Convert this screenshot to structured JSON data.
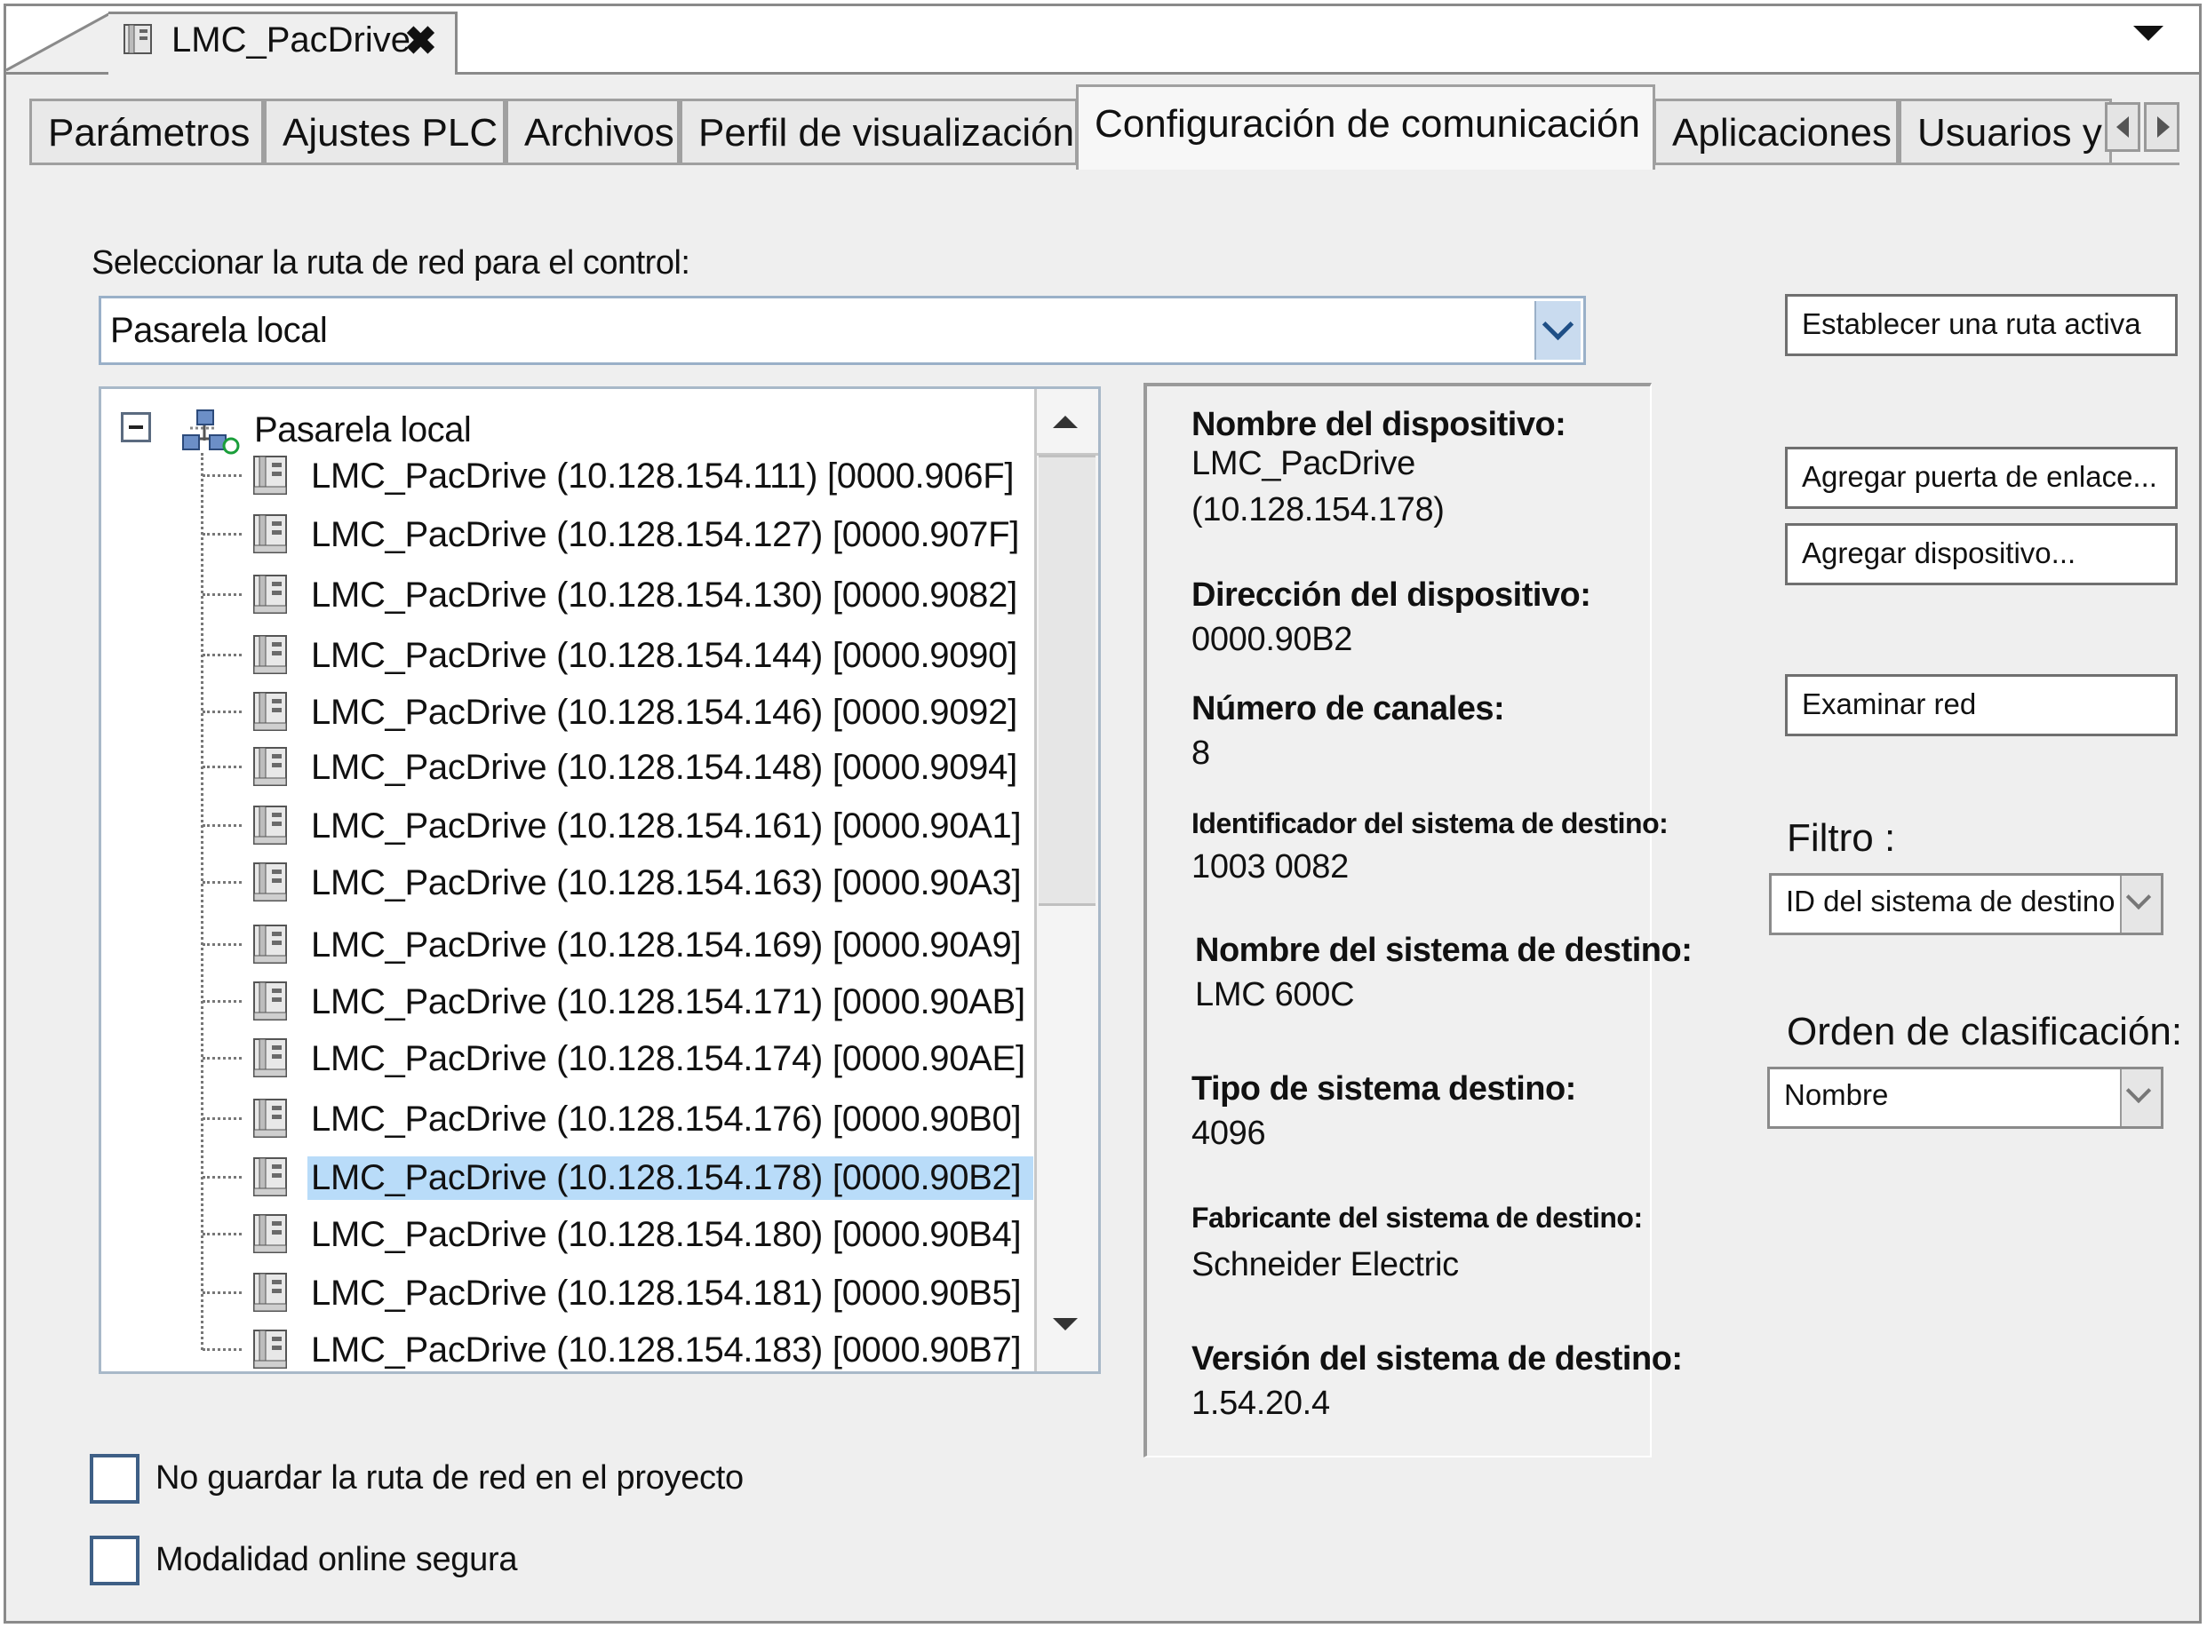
{
  "document_tab": {
    "title": "LMC_PacDrive",
    "close_glyph": "✖"
  },
  "tabs": [
    {
      "label": "Parámetros",
      "active": false
    },
    {
      "label": "Ajustes PLC",
      "active": false
    },
    {
      "label": "Archivos",
      "active": false
    },
    {
      "label": "Perfil de visualización",
      "active": false
    },
    {
      "label": "Configuración de comunicación",
      "active": true
    },
    {
      "label": "Aplicaciones",
      "active": false
    },
    {
      "label": "Usuarios y grupos",
      "active": false
    }
  ],
  "route": {
    "label": "Seleccionar la ruta de red para el control:",
    "value": "Pasarela local"
  },
  "tree": {
    "root": "Pasarela local",
    "nodes": [
      "LMC_PacDrive (10.128.154.111) [0000.906F]",
      "LMC_PacDrive (10.128.154.127) [0000.907F]",
      "LMC_PacDrive (10.128.154.130) [0000.9082]",
      "LMC_PacDrive (10.128.154.144) [0000.9090]",
      "LMC_PacDrive (10.128.154.146) [0000.9092]",
      "LMC_PacDrive (10.128.154.148) [0000.9094]",
      "LMC_PacDrive (10.128.154.161) [0000.90A1]",
      "LMC_PacDrive (10.128.154.163) [0000.90A3]",
      "LMC_PacDrive (10.128.154.169) [0000.90A9]",
      "LMC_PacDrive (10.128.154.171) [0000.90AB]",
      "LMC_PacDrive (10.128.154.174) [0000.90AE]",
      "LMC_PacDrive (10.128.154.176) [0000.90B0]",
      "LMC_PacDrive (10.128.154.178) [0000.90B2]",
      "LMC_PacDrive (10.128.154.180) [0000.90B4]",
      "LMC_PacDrive (10.128.154.181) [0000.90B5]",
      "LMC_PacDrive (10.128.154.183) [0000.90B7]"
    ],
    "selected_index": 12
  },
  "device_info": {
    "name_label": "Nombre del dispositivo:",
    "name_value_1": "LMC_PacDrive",
    "name_value_2": "(10.128.154.178)",
    "address_label": "Dirección del dispositivo:",
    "address_value": "0000.90B2",
    "channels_label": "Número de canales:",
    "channels_value": "8",
    "target_id_label": "Identificador del sistema de destino:",
    "target_id_value": "1003 0082",
    "target_name_label": "Nombre del sistema de destino:",
    "target_name_value": "LMC 600C",
    "target_type_label": "Tipo de sistema destino:",
    "target_type_value": "4096",
    "vendor_label": "Fabricante del sistema de destino:",
    "vendor_value": "Schneider Electric",
    "version_label": "Versión del sistema de destino:",
    "version_value": "1.54.20.4"
  },
  "actions": {
    "set_active_path": "Establecer una ruta activa",
    "add_gateway": "Agregar puerta de enlace...",
    "add_device": "Agregar dispositivo...",
    "scan_network": "Examinar red"
  },
  "filter": {
    "label": "Filtro :",
    "value": "ID del sistema de destino"
  },
  "sort": {
    "label": "Orden de clasificación:",
    "value": "Nombre"
  },
  "options": {
    "dont_save_route": "No guardar la ruta de red en el proyecto",
    "secure_online": "Modalidad online segura"
  },
  "colors": {
    "selection": "#b9dcf9",
    "combo_button": "#c9dbef",
    "checkbox_border": "#3e5f86"
  }
}
